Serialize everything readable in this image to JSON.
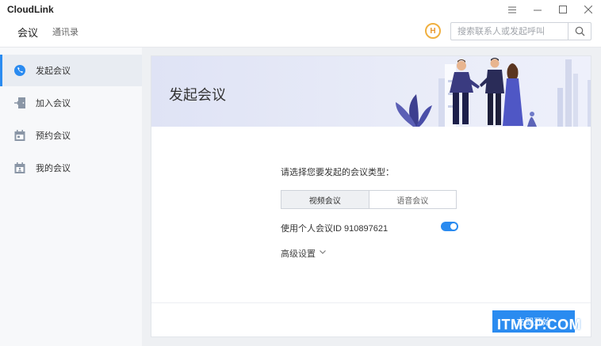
{
  "app": {
    "title": "CloudLink"
  },
  "window": {
    "minimize_icon": "menu-icon",
    "restore": "minimize-icon",
    "maximize": "maximize-icon",
    "close": "close-icon"
  },
  "nav": {
    "tabs": [
      {
        "label": "会议",
        "active": true
      },
      {
        "label": "通讯录",
        "active": false
      }
    ],
    "logo_letter": "H",
    "search": {
      "placeholder": "搜索联系人或发起呼叫",
      "value": ""
    }
  },
  "sidebar": {
    "items": [
      {
        "label": "发起会议",
        "icon": "phone-call-icon",
        "active": true
      },
      {
        "label": "加入会议",
        "icon": "door-enter-icon",
        "active": false
      },
      {
        "label": "预约会议",
        "icon": "calendar-icon",
        "active": false
      },
      {
        "label": "我的会议",
        "icon": "calendar-person-icon",
        "active": false
      }
    ]
  },
  "main": {
    "banner_title": "发起会议",
    "prompt": "请选择您要发起的会议类型：",
    "types": [
      {
        "label": "视频会议",
        "selected": true
      },
      {
        "label": "语音会议",
        "selected": false
      }
    ],
    "personal_id_label": "使用个人会议ID 910897621",
    "personal_id_enabled": true,
    "advanced_label": "高级设置",
    "start_button": "立即开始"
  },
  "watermark": "ITMOP.COM",
  "colors": {
    "accent": "#2a8bf0",
    "sidebar_bg": "#f7f8fa",
    "main_bg": "#eef0f3",
    "banner_bg": "#e4e7f6"
  }
}
